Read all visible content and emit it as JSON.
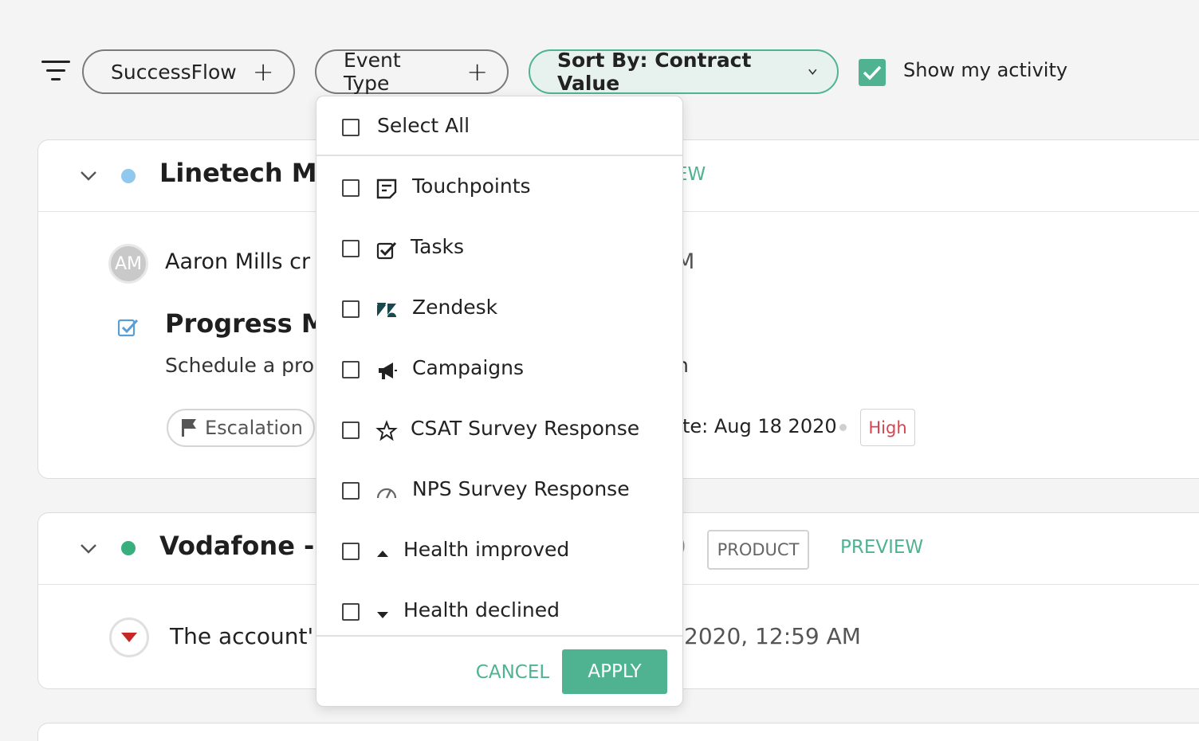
{
  "filters": {
    "successflow_label": "SuccessFlow",
    "event_type_label": "Event Type",
    "add_symbol": "+",
    "sort_label": "Sort By: Contract Value",
    "show_activity_label": "Show my activity",
    "show_activity_checked": true
  },
  "cards": [
    {
      "account": "Linetech MN",
      "dot_color": "#90c8ee",
      "preview_fragment": "EW",
      "avatar_initials": "AM",
      "creator_text": "Aaron Mills cr",
      "time_fragment": "M",
      "task_title": "Progress Me",
      "task_desc": "Schedule a pro",
      "desc_fragment": "n",
      "escalation_label": "Escalation",
      "due_text": "te: Aug 18 2020",
      "priority": "High"
    },
    {
      "account": "Vodafone -",
      "dot_color": "#3aaf7e",
      "paren_fragment": ")",
      "tag": "PRODUCT",
      "preview": "PREVIEW",
      "event_text": "The account'",
      "event_time": "2020, 12:59 AM"
    }
  ],
  "dropdown": {
    "select_all": "Select All",
    "options": [
      {
        "label": "Touchpoints",
        "icon": "touchpoint-note-icon",
        "checked": false
      },
      {
        "label": "Tasks",
        "icon": "task-check-icon",
        "checked": false
      },
      {
        "label": "Zendesk",
        "icon": "zendesk-icon",
        "checked": false
      },
      {
        "label": "Campaigns",
        "icon": "megaphone-icon",
        "checked": false
      },
      {
        "label": "CSAT Survey Response",
        "icon": "star-icon",
        "checked": false
      },
      {
        "label": "NPS Survey Response",
        "icon": "gauge-icon",
        "checked": false
      },
      {
        "label": "Health improved",
        "icon": "triangle-up-icon",
        "checked": false
      },
      {
        "label": "Health declined",
        "icon": "triangle-down-icon",
        "checked": false
      }
    ],
    "cancel": "CANCEL",
    "apply": "APPLY"
  },
  "colors": {
    "accent": "#4fb391",
    "priority_high": "#d9434f",
    "health_declined": "#c62828"
  }
}
